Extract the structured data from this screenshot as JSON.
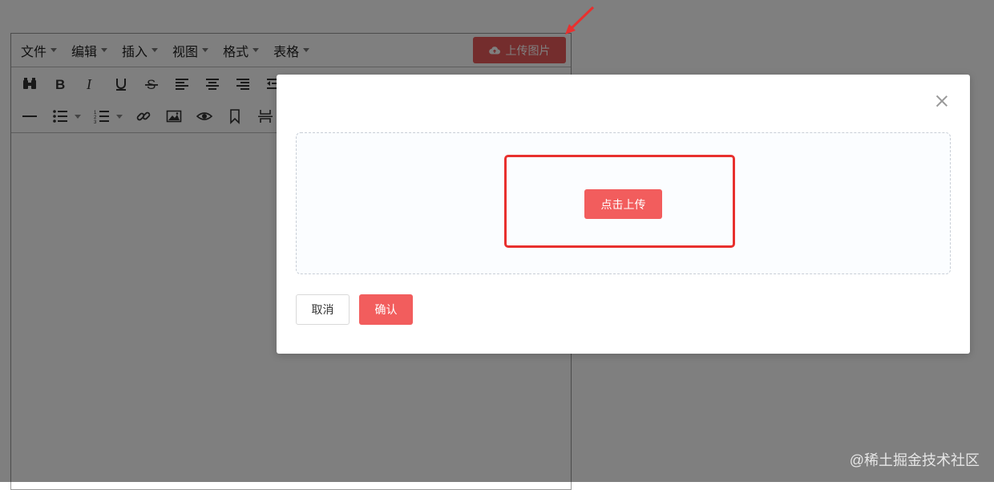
{
  "menubar": {
    "items": [
      {
        "label": "文件"
      },
      {
        "label": "编辑"
      },
      {
        "label": "插入"
      },
      {
        "label": "视图"
      },
      {
        "label": "格式"
      },
      {
        "label": "表格"
      }
    ],
    "upload_image_label": "上传图片"
  },
  "modal": {
    "click_upload_label": "点击上传",
    "cancel_label": "取消",
    "confirm_label": "确认"
  },
  "watermark": "@稀土掘金技术社区",
  "colors": {
    "accent": "#f25d5d",
    "annotation": "#e8302e"
  }
}
